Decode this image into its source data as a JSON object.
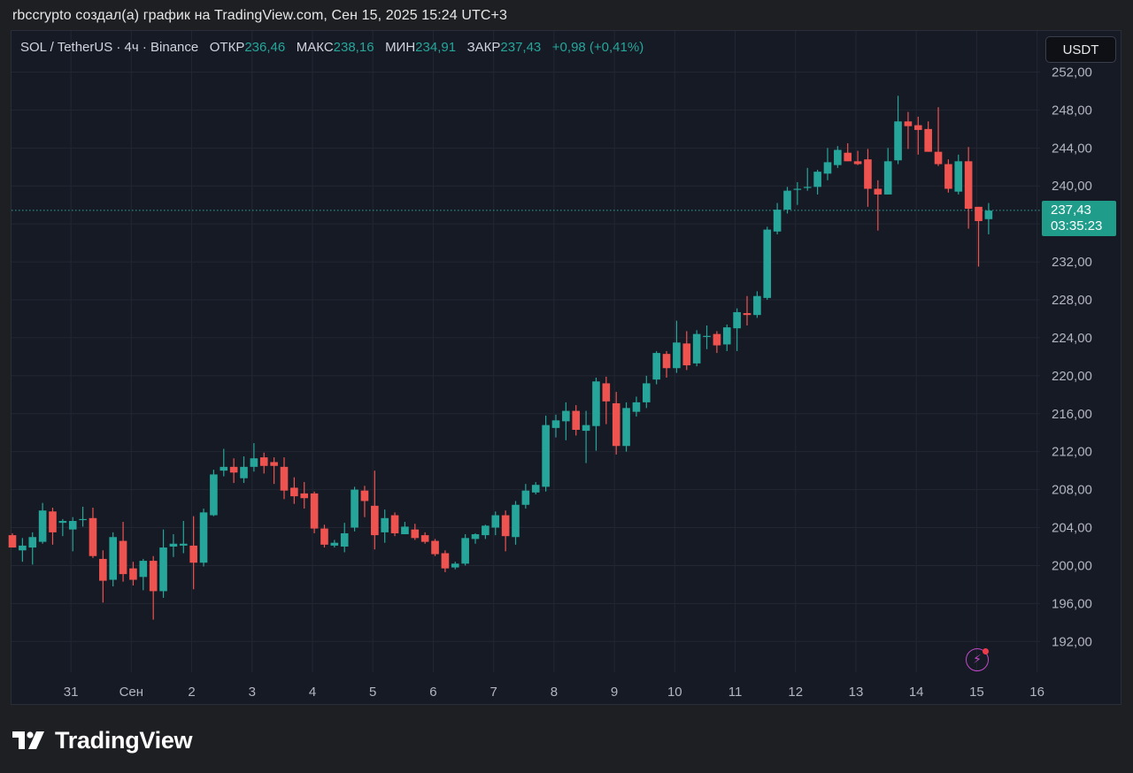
{
  "caption": "rbccrypto создал(а) график на TradingView.com, Сен 15, 2025 15:24 UTC+3",
  "header": {
    "symbol": "SOL / TetherUS · 4ч · Binance",
    "open_label": "ОТКР",
    "open_value": "236,46",
    "high_label": "МАКС",
    "high_value": "238,16",
    "low_label": "МИН",
    "low_value": "234,91",
    "close_label": "ЗАКР",
    "close_value": "237,43",
    "change": "+0,98 (+0,41%)"
  },
  "currency_button": "USDT",
  "price_tag": {
    "price": "237,43",
    "countdown": "03:35:23"
  },
  "logo_text": "TradingView",
  "colors": {
    "up": "#26a69a",
    "down": "#ef5350",
    "background": "#161a25",
    "grid": "#232733",
    "accent_bolt": "#c04ac8"
  },
  "icons": [
    "tradingview-logo-icon",
    "lightning-icon"
  ],
  "chart_data": {
    "type": "candlestick",
    "ylim": [
      188,
      252
    ],
    "y_ticks": [
      "192,00",
      "196,00",
      "200,00",
      "204,00",
      "208,00",
      "212,00",
      "216,00",
      "220,00",
      "224,00",
      "228,00",
      "232,00",
      "236,00",
      "240,00",
      "244,00",
      "248,00",
      "252,00"
    ],
    "y_tick_values": [
      192,
      196,
      200,
      204,
      208,
      212,
      216,
      220,
      224,
      228,
      232,
      236,
      240,
      244,
      248,
      252
    ],
    "x_ticks": [
      "31",
      "Сен",
      "2",
      "3",
      "4",
      "5",
      "6",
      "7",
      "8",
      "9",
      "10",
      "11",
      "12",
      "13",
      "14",
      "15",
      "16"
    ],
    "x_tick_index": [
      3,
      9,
      15,
      21,
      27,
      33,
      39,
      45,
      51,
      57,
      63,
      69,
      75,
      81,
      87,
      93,
      99
    ],
    "last_price": 237.43,
    "candles": [
      {
        "o": 203.2,
        "h": 203.4,
        "l": 201.9,
        "c": 201.9
      },
      {
        "o": 201.6,
        "h": 202.9,
        "l": 200.4,
        "c": 202.1
      },
      {
        "o": 201.9,
        "h": 203.5,
        "l": 200.1,
        "c": 203.0
      },
      {
        "o": 202.5,
        "h": 206.6,
        "l": 202.3,
        "c": 205.8
      },
      {
        "o": 205.7,
        "h": 206.1,
        "l": 202.2,
        "c": 203.5
      },
      {
        "o": 204.5,
        "h": 204.9,
        "l": 203.1,
        "c": 204.7
      },
      {
        "o": 203.8,
        "h": 205.1,
        "l": 201.5,
        "c": 204.7
      },
      {
        "o": 204.8,
        "h": 206.2,
        "l": 204.1,
        "c": 204.9
      },
      {
        "o": 205.0,
        "h": 206.1,
        "l": 200.8,
        "c": 201.0
      },
      {
        "o": 200.7,
        "h": 201.6,
        "l": 196.1,
        "c": 198.4
      },
      {
        "o": 198.5,
        "h": 203.5,
        "l": 197.8,
        "c": 203.0
      },
      {
        "o": 202.6,
        "h": 204.6,
        "l": 198.3,
        "c": 199.1
      },
      {
        "o": 199.7,
        "h": 200.4,
        "l": 197.9,
        "c": 198.5
      },
      {
        "o": 198.8,
        "h": 200.7,
        "l": 197.4,
        "c": 200.5
      },
      {
        "o": 200.5,
        "h": 201.0,
        "l": 194.3,
        "c": 197.3
      },
      {
        "o": 197.3,
        "h": 203.8,
        "l": 196.6,
        "c": 201.9
      },
      {
        "o": 202.0,
        "h": 203.3,
        "l": 200.9,
        "c": 202.3
      },
      {
        "o": 202.1,
        "h": 204.7,
        "l": 201.3,
        "c": 202.3
      },
      {
        "o": 202.1,
        "h": 205.2,
        "l": 197.5,
        "c": 200.3
      },
      {
        "o": 200.3,
        "h": 206.0,
        "l": 199.9,
        "c": 205.6
      },
      {
        "o": 205.3,
        "h": 210.1,
        "l": 205.2,
        "c": 209.6
      },
      {
        "o": 210.0,
        "h": 212.3,
        "l": 209.4,
        "c": 210.4
      },
      {
        "o": 210.4,
        "h": 211.3,
        "l": 208.7,
        "c": 209.8
      },
      {
        "o": 209.2,
        "h": 211.5,
        "l": 208.7,
        "c": 210.4
      },
      {
        "o": 210.4,
        "h": 212.9,
        "l": 209.9,
        "c": 211.3
      },
      {
        "o": 211.4,
        "h": 211.9,
        "l": 209.7,
        "c": 210.5
      },
      {
        "o": 210.9,
        "h": 211.4,
        "l": 208.6,
        "c": 210.5
      },
      {
        "o": 210.4,
        "h": 211.4,
        "l": 207.0,
        "c": 207.9
      },
      {
        "o": 208.2,
        "h": 209.3,
        "l": 206.5,
        "c": 207.3
      },
      {
        "o": 207.6,
        "h": 208.8,
        "l": 206.0,
        "c": 207.1
      },
      {
        "o": 207.6,
        "h": 207.8,
        "l": 203.4,
        "c": 203.9
      },
      {
        "o": 203.9,
        "h": 204.3,
        "l": 201.9,
        "c": 202.2
      },
      {
        "o": 202.1,
        "h": 202.7,
        "l": 201.9,
        "c": 202.4
      },
      {
        "o": 202.0,
        "h": 204.5,
        "l": 201.4,
        "c": 203.4
      },
      {
        "o": 204.0,
        "h": 208.3,
        "l": 203.6,
        "c": 208.0
      },
      {
        "o": 207.9,
        "h": 208.4,
        "l": 205.1,
        "c": 206.8
      },
      {
        "o": 206.3,
        "h": 210.0,
        "l": 201.7,
        "c": 203.2
      },
      {
        "o": 203.5,
        "h": 205.9,
        "l": 202.4,
        "c": 205.0
      },
      {
        "o": 205.3,
        "h": 205.6,
        "l": 203.1,
        "c": 203.4
      },
      {
        "o": 203.3,
        "h": 204.6,
        "l": 203.3,
        "c": 204.1
      },
      {
        "o": 203.8,
        "h": 204.4,
        "l": 202.7,
        "c": 202.9
      },
      {
        "o": 203.2,
        "h": 203.5,
        "l": 202.3,
        "c": 202.5
      },
      {
        "o": 202.6,
        "h": 202.8,
        "l": 201.0,
        "c": 201.2
      },
      {
        "o": 201.3,
        "h": 201.6,
        "l": 199.3,
        "c": 199.7
      },
      {
        "o": 199.8,
        "h": 200.4,
        "l": 199.6,
        "c": 200.2
      },
      {
        "o": 200.2,
        "h": 203.3,
        "l": 200.0,
        "c": 202.9
      },
      {
        "o": 202.8,
        "h": 203.4,
        "l": 202.3,
        "c": 203.3
      },
      {
        "o": 203.2,
        "h": 204.3,
        "l": 202.8,
        "c": 204.2
      },
      {
        "o": 204.0,
        "h": 205.7,
        "l": 203.2,
        "c": 205.3
      },
      {
        "o": 205.3,
        "h": 205.8,
        "l": 201.5,
        "c": 203.1
      },
      {
        "o": 203.0,
        "h": 206.8,
        "l": 202.2,
        "c": 206.4
      },
      {
        "o": 206.4,
        "h": 208.6,
        "l": 206.0,
        "c": 207.9
      },
      {
        "o": 207.7,
        "h": 208.8,
        "l": 207.5,
        "c": 208.5
      },
      {
        "o": 208.3,
        "h": 215.8,
        "l": 207.8,
        "c": 214.8
      },
      {
        "o": 214.5,
        "h": 215.9,
        "l": 213.5,
        "c": 215.3
      },
      {
        "o": 215.2,
        "h": 217.2,
        "l": 213.2,
        "c": 216.3
      },
      {
        "o": 216.3,
        "h": 216.9,
        "l": 213.7,
        "c": 214.3
      },
      {
        "o": 214.2,
        "h": 216.3,
        "l": 210.8,
        "c": 214.8
      },
      {
        "o": 214.7,
        "h": 219.8,
        "l": 212.1,
        "c": 219.4
      },
      {
        "o": 219.2,
        "h": 219.9,
        "l": 214.9,
        "c": 217.3
      },
      {
        "o": 217.1,
        "h": 218.3,
        "l": 211.7,
        "c": 212.6
      },
      {
        "o": 212.6,
        "h": 217.2,
        "l": 212.0,
        "c": 216.6
      },
      {
        "o": 216.2,
        "h": 217.8,
        "l": 215.7,
        "c": 217.2
      },
      {
        "o": 217.2,
        "h": 220.0,
        "l": 216.6,
        "c": 219.2
      },
      {
        "o": 219.6,
        "h": 222.6,
        "l": 219.1,
        "c": 222.4
      },
      {
        "o": 222.3,
        "h": 222.6,
        "l": 219.8,
        "c": 220.8
      },
      {
        "o": 220.8,
        "h": 225.8,
        "l": 220.3,
        "c": 223.5
      },
      {
        "o": 223.4,
        "h": 224.7,
        "l": 220.6,
        "c": 221.1
      },
      {
        "o": 221.3,
        "h": 224.8,
        "l": 221.0,
        "c": 224.4
      },
      {
        "o": 224.2,
        "h": 225.3,
        "l": 222.8,
        "c": 224.2
      },
      {
        "o": 224.4,
        "h": 224.7,
        "l": 222.4,
        "c": 223.2
      },
      {
        "o": 223.3,
        "h": 225.4,
        "l": 222.6,
        "c": 225.1
      },
      {
        "o": 225.0,
        "h": 227.1,
        "l": 222.6,
        "c": 226.7
      },
      {
        "o": 226.6,
        "h": 228.4,
        "l": 225.3,
        "c": 226.4
      },
      {
        "o": 226.4,
        "h": 228.9,
        "l": 226.1,
        "c": 228.4
      },
      {
        "o": 228.2,
        "h": 235.7,
        "l": 228.0,
        "c": 235.4
      },
      {
        "o": 235.2,
        "h": 238.2,
        "l": 234.9,
        "c": 237.5
      },
      {
        "o": 237.5,
        "h": 239.9,
        "l": 237.1,
        "c": 239.5
      },
      {
        "o": 239.6,
        "h": 240.4,
        "l": 238.0,
        "c": 239.7
      },
      {
        "o": 239.8,
        "h": 241.9,
        "l": 239.5,
        "c": 239.9
      },
      {
        "o": 239.9,
        "h": 241.7,
        "l": 239.1,
        "c": 241.5
      },
      {
        "o": 241.3,
        "h": 244.0,
        "l": 240.6,
        "c": 242.5
      },
      {
        "o": 242.2,
        "h": 244.2,
        "l": 241.9,
        "c": 243.8
      },
      {
        "o": 243.5,
        "h": 244.5,
        "l": 242.6,
        "c": 242.6
      },
      {
        "o": 242.6,
        "h": 243.7,
        "l": 242.2,
        "c": 242.3
      },
      {
        "o": 242.8,
        "h": 243.9,
        "l": 237.8,
        "c": 239.7
      },
      {
        "o": 239.7,
        "h": 240.6,
        "l": 235.3,
        "c": 239.1
      },
      {
        "o": 239.1,
        "h": 244.0,
        "l": 239.1,
        "c": 242.6
      },
      {
        "o": 242.7,
        "h": 249.5,
        "l": 242.3,
        "c": 246.8
      },
      {
        "o": 246.8,
        "h": 247.8,
        "l": 243.9,
        "c": 246.3
      },
      {
        "o": 246.4,
        "h": 247.3,
        "l": 243.3,
        "c": 245.9
      },
      {
        "o": 246.0,
        "h": 246.8,
        "l": 243.6,
        "c": 243.6
      },
      {
        "o": 243.6,
        "h": 248.3,
        "l": 242.1,
        "c": 242.3
      },
      {
        "o": 242.3,
        "h": 242.8,
        "l": 239.3,
        "c": 239.7
      },
      {
        "o": 239.4,
        "h": 243.3,
        "l": 239.1,
        "c": 242.6
      },
      {
        "o": 242.6,
        "h": 244.1,
        "l": 235.5,
        "c": 237.6
      },
      {
        "o": 237.8,
        "h": 237.8,
        "l": 231.5,
        "c": 236.3
      },
      {
        "o": 236.5,
        "h": 238.2,
        "l": 234.9,
        "c": 237.4
      }
    ]
  }
}
